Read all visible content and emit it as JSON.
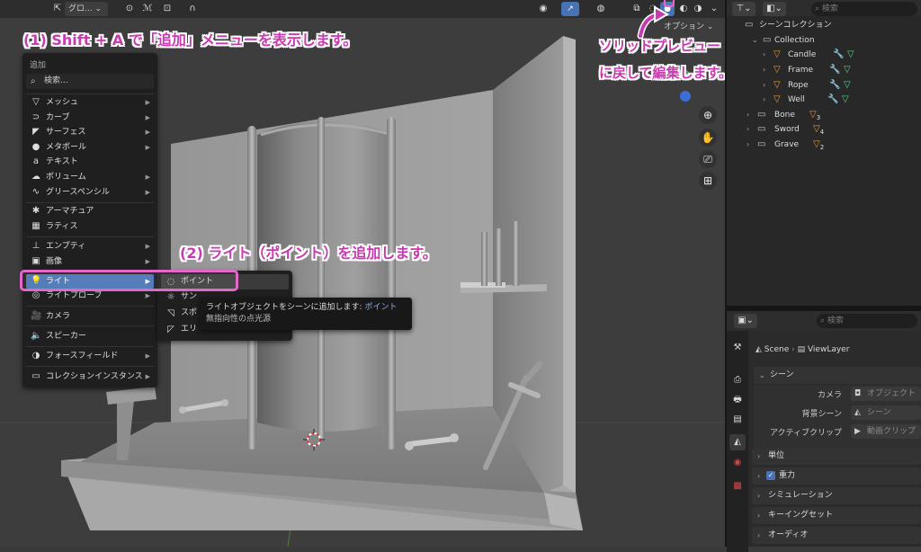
{
  "viewport": {
    "header": {
      "view_dropdown": "グロ...",
      "options_label": "オプション"
    }
  },
  "annotations": {
    "step1": "(1) Shift + A で「追加」メニューを表示します。",
    "step2": "(2) ライト（ポイント）を追加します。",
    "solid_line1": "ソリッドプレビュー",
    "solid_line2": "に戻して編集します。"
  },
  "add_menu": {
    "title": "追加",
    "search": "検索...",
    "items": [
      {
        "label": "メッシュ",
        "icon": "mesh-icon",
        "arrow": true
      },
      {
        "label": "カーブ",
        "icon": "curve-icon",
        "arrow": true
      },
      {
        "label": "サーフェス",
        "icon": "surface-icon",
        "arrow": true
      },
      {
        "label": "メタボール",
        "icon": "metaball-icon",
        "arrow": true
      },
      {
        "label": "テキスト",
        "icon": "text-icon",
        "arrow": false
      },
      {
        "label": "ボリューム",
        "icon": "volume-icon",
        "arrow": true
      },
      {
        "label": "グリースペンシル",
        "icon": "grease-pencil-icon",
        "arrow": true
      },
      {
        "label": "アーマチュア",
        "icon": "armature-icon",
        "arrow": false
      },
      {
        "label": "ラティス",
        "icon": "lattice-icon",
        "arrow": false
      },
      {
        "label": "エンプティ",
        "icon": "empty-icon",
        "arrow": true
      },
      {
        "label": "画像",
        "icon": "image-icon",
        "arrow": true
      },
      {
        "label": "ライト",
        "icon": "light-icon",
        "arrow": true
      },
      {
        "label": "ライトプローブ",
        "icon": "light-probe-icon",
        "arrow": true
      },
      {
        "label": "カメラ",
        "icon": "camera-icon",
        "arrow": false
      },
      {
        "label": "スピーカー",
        "icon": "speaker-icon",
        "arrow": false
      },
      {
        "label": "フォースフィールド",
        "icon": "force-field-icon",
        "arrow": true
      },
      {
        "label": "コレクションインスタンス",
        "icon": "collection-instance-icon",
        "arrow": true
      }
    ]
  },
  "light_submenu": {
    "items": [
      {
        "label": "ポイント",
        "icon": "point-light-icon"
      },
      {
        "label": "サン",
        "icon": "sun-light-icon"
      },
      {
        "label": "スポ",
        "icon": "spot-light-icon"
      },
      {
        "label": "エリ",
        "icon": "area-light-icon"
      }
    ]
  },
  "tooltip": {
    "line1_main": "ライトオブジェクトをシーンに追加します:",
    "line1_highlight": "ポイント",
    "line2": "無指向性の点光源"
  },
  "outliner": {
    "search_placeholder": "検索",
    "scene_collection": "シーンコレクション",
    "rows": [
      {
        "name": "Collection",
        "type": "collection",
        "count": ""
      },
      {
        "name": "Candle",
        "type": "object",
        "count": ""
      },
      {
        "name": "Frame",
        "type": "object",
        "count": ""
      },
      {
        "name": "Rope",
        "type": "object",
        "count": ""
      },
      {
        "name": "Well",
        "type": "object",
        "count": ""
      },
      {
        "name": "Bone",
        "type": "collection",
        "count": "3"
      },
      {
        "name": "Sword",
        "type": "collection",
        "count": "4"
      },
      {
        "name": "Grave",
        "type": "collection",
        "count": "2"
      }
    ]
  },
  "properties": {
    "search_placeholder": "検索",
    "breadcrumb_scene": "Scene",
    "breadcrumb_viewlayer": "ViewLayer",
    "scene_panel": "シーン",
    "camera_label": "カメラ",
    "camera_value": "オブジェクト",
    "background_label": "背景シーン",
    "background_value": "シーン",
    "clip_label": "アクティブクリップ",
    "clip_value": "動画クリップ",
    "panels": [
      "単位",
      "重力",
      "シミュレーション",
      "キーイングセット",
      "オーディオ"
    ]
  },
  "colors": {
    "accent": "#4772b3",
    "annotation": "#c83ab0",
    "annotation_box": "#e268cc",
    "object_orange": "#e89a3c",
    "modifier_blue": "#6fa8ff",
    "data_green": "#5fd08c"
  }
}
